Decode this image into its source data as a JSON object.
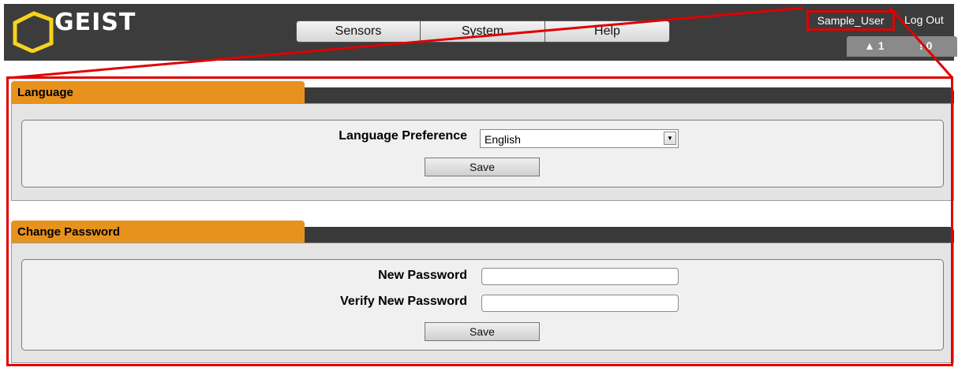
{
  "header": {
    "logo_text": "GEIST",
    "nav": [
      "Sensors",
      "System",
      "Help"
    ],
    "user": "Sample_User",
    "logout": "Log Out",
    "alarms": {
      "warning_count": "1",
      "alert_count": "0"
    }
  },
  "language_panel": {
    "title": "Language",
    "pref_label": "Language Preference",
    "pref_value": "English",
    "save_label": "Save"
  },
  "password_panel": {
    "title": "Change Password",
    "new_label": "New Password",
    "verify_label": "Verify New Password",
    "save_label": "Save"
  },
  "colors": {
    "accent_tab": "#e8921e",
    "highlight": "#e00000",
    "header_bg": "#3c3c3c"
  }
}
